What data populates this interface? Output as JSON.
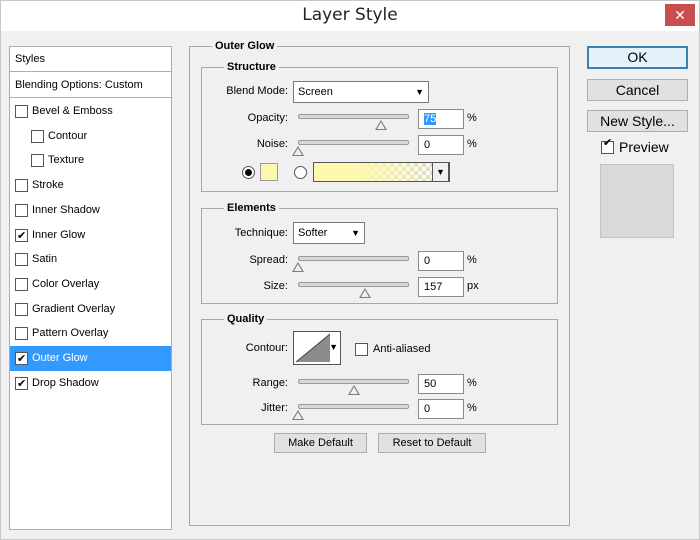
{
  "window": {
    "title": "Layer Style",
    "close_glyph": "✕"
  },
  "styles_panel": {
    "header": "Styles",
    "blending": "Blending Options: Custom",
    "items": [
      {
        "label": "Bevel & Emboss",
        "checked": false,
        "indent": false
      },
      {
        "label": "Contour",
        "checked": false,
        "indent": true
      },
      {
        "label": "Texture",
        "checked": false,
        "indent": true
      },
      {
        "label": "Stroke",
        "checked": false,
        "indent": false
      },
      {
        "label": "Inner Shadow",
        "checked": false,
        "indent": false
      },
      {
        "label": "Inner Glow",
        "checked": true,
        "indent": false
      },
      {
        "label": "Satin",
        "checked": false,
        "indent": false
      },
      {
        "label": "Color Overlay",
        "checked": false,
        "indent": false
      },
      {
        "label": "Gradient Overlay",
        "checked": false,
        "indent": false
      },
      {
        "label": "Pattern Overlay",
        "checked": false,
        "indent": false
      },
      {
        "label": "Outer Glow",
        "checked": true,
        "indent": false,
        "selected": true
      },
      {
        "label": "Drop Shadow",
        "checked": true,
        "indent": false
      }
    ]
  },
  "outer_glow": {
    "title": "Outer Glow",
    "structure": {
      "title": "Structure",
      "blend_mode_label": "Blend Mode:",
      "blend_mode_value": "Screen",
      "opacity_label": "Opacity:",
      "opacity_value": "75",
      "opacity_unit": "%",
      "opacity_level": 0.75,
      "noise_label": "Noise:",
      "noise_value": "0",
      "noise_unit": "%",
      "noise_level": 0.0,
      "glow_color": "#fdf7b0"
    },
    "elements": {
      "title": "Elements",
      "technique_label": "Technique:",
      "technique_value": "Softer",
      "spread_label": "Spread:",
      "spread_value": "0",
      "spread_unit": "%",
      "spread_level": 0.0,
      "size_label": "Size:",
      "size_value": "157",
      "size_unit": "px",
      "size_level": 0.6
    },
    "quality": {
      "title": "Quality",
      "contour_label": "Contour:",
      "anti_aliased_label": "Anti-aliased",
      "anti_aliased": false,
      "range_label": "Range:",
      "range_value": "50",
      "range_unit": "%",
      "range_level": 0.5,
      "jitter_label": "Jitter:",
      "jitter_value": "0",
      "jitter_unit": "%",
      "jitter_level": 0.0
    },
    "make_default": "Make Default",
    "reset_default": "Reset to Default"
  },
  "actions": {
    "ok": "OK",
    "cancel": "Cancel",
    "new_style": "New Style...",
    "preview_label": "Preview",
    "preview_checked": true
  },
  "colors": {
    "selection": "#3399ff",
    "glow": "#fdf7b0"
  }
}
